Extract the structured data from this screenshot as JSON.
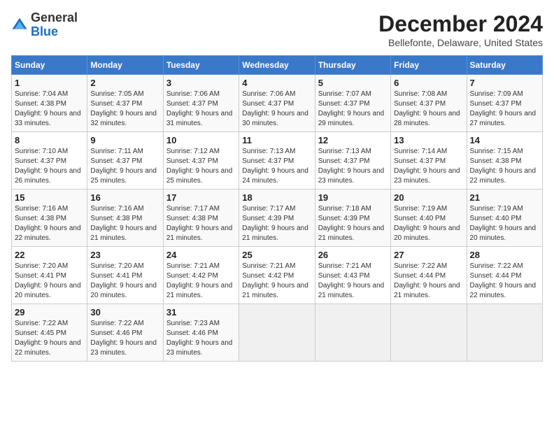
{
  "logo": {
    "general": "General",
    "blue": "Blue"
  },
  "title": "December 2024",
  "subtitle": "Bellefonte, Delaware, United States",
  "days_header": [
    "Sunday",
    "Monday",
    "Tuesday",
    "Wednesday",
    "Thursday",
    "Friday",
    "Saturday"
  ],
  "weeks": [
    [
      {
        "day": "1",
        "sunrise": "Sunrise: 7:04 AM",
        "sunset": "Sunset: 4:38 PM",
        "daylight": "Daylight: 9 hours and 33 minutes."
      },
      {
        "day": "2",
        "sunrise": "Sunrise: 7:05 AM",
        "sunset": "Sunset: 4:37 PM",
        "daylight": "Daylight: 9 hours and 32 minutes."
      },
      {
        "day": "3",
        "sunrise": "Sunrise: 7:06 AM",
        "sunset": "Sunset: 4:37 PM",
        "daylight": "Daylight: 9 hours and 31 minutes."
      },
      {
        "day": "4",
        "sunrise": "Sunrise: 7:06 AM",
        "sunset": "Sunset: 4:37 PM",
        "daylight": "Daylight: 9 hours and 30 minutes."
      },
      {
        "day": "5",
        "sunrise": "Sunrise: 7:07 AM",
        "sunset": "Sunset: 4:37 PM",
        "daylight": "Daylight: 9 hours and 29 minutes."
      },
      {
        "day": "6",
        "sunrise": "Sunrise: 7:08 AM",
        "sunset": "Sunset: 4:37 PM",
        "daylight": "Daylight: 9 hours and 28 minutes."
      },
      {
        "day": "7",
        "sunrise": "Sunrise: 7:09 AM",
        "sunset": "Sunset: 4:37 PM",
        "daylight": "Daylight: 9 hours and 27 minutes."
      }
    ],
    [
      {
        "day": "8",
        "sunrise": "Sunrise: 7:10 AM",
        "sunset": "Sunset: 4:37 PM",
        "daylight": "Daylight: 9 hours and 26 minutes."
      },
      {
        "day": "9",
        "sunrise": "Sunrise: 7:11 AM",
        "sunset": "Sunset: 4:37 PM",
        "daylight": "Daylight: 9 hours and 25 minutes."
      },
      {
        "day": "10",
        "sunrise": "Sunrise: 7:12 AM",
        "sunset": "Sunset: 4:37 PM",
        "daylight": "Daylight: 9 hours and 25 minutes."
      },
      {
        "day": "11",
        "sunrise": "Sunrise: 7:13 AM",
        "sunset": "Sunset: 4:37 PM",
        "daylight": "Daylight: 9 hours and 24 minutes."
      },
      {
        "day": "12",
        "sunrise": "Sunrise: 7:13 AM",
        "sunset": "Sunset: 4:37 PM",
        "daylight": "Daylight: 9 hours and 23 minutes."
      },
      {
        "day": "13",
        "sunrise": "Sunrise: 7:14 AM",
        "sunset": "Sunset: 4:37 PM",
        "daylight": "Daylight: 9 hours and 23 minutes."
      },
      {
        "day": "14",
        "sunrise": "Sunrise: 7:15 AM",
        "sunset": "Sunset: 4:38 PM",
        "daylight": "Daylight: 9 hours and 22 minutes."
      }
    ],
    [
      {
        "day": "15",
        "sunrise": "Sunrise: 7:16 AM",
        "sunset": "Sunset: 4:38 PM",
        "daylight": "Daylight: 9 hours and 22 minutes."
      },
      {
        "day": "16",
        "sunrise": "Sunrise: 7:16 AM",
        "sunset": "Sunset: 4:38 PM",
        "daylight": "Daylight: 9 hours and 21 minutes."
      },
      {
        "day": "17",
        "sunrise": "Sunrise: 7:17 AM",
        "sunset": "Sunset: 4:38 PM",
        "daylight": "Daylight: 9 hours and 21 minutes."
      },
      {
        "day": "18",
        "sunrise": "Sunrise: 7:17 AM",
        "sunset": "Sunset: 4:39 PM",
        "daylight": "Daylight: 9 hours and 21 minutes."
      },
      {
        "day": "19",
        "sunrise": "Sunrise: 7:18 AM",
        "sunset": "Sunset: 4:39 PM",
        "daylight": "Daylight: 9 hours and 21 minutes."
      },
      {
        "day": "20",
        "sunrise": "Sunrise: 7:19 AM",
        "sunset": "Sunset: 4:40 PM",
        "daylight": "Daylight: 9 hours and 20 minutes."
      },
      {
        "day": "21",
        "sunrise": "Sunrise: 7:19 AM",
        "sunset": "Sunset: 4:40 PM",
        "daylight": "Daylight: 9 hours and 20 minutes."
      }
    ],
    [
      {
        "day": "22",
        "sunrise": "Sunrise: 7:20 AM",
        "sunset": "Sunset: 4:41 PM",
        "daylight": "Daylight: 9 hours and 20 minutes."
      },
      {
        "day": "23",
        "sunrise": "Sunrise: 7:20 AM",
        "sunset": "Sunset: 4:41 PM",
        "daylight": "Daylight: 9 hours and 20 minutes."
      },
      {
        "day": "24",
        "sunrise": "Sunrise: 7:21 AM",
        "sunset": "Sunset: 4:42 PM",
        "daylight": "Daylight: 9 hours and 21 minutes."
      },
      {
        "day": "25",
        "sunrise": "Sunrise: 7:21 AM",
        "sunset": "Sunset: 4:42 PM",
        "daylight": "Daylight: 9 hours and 21 minutes."
      },
      {
        "day": "26",
        "sunrise": "Sunrise: 7:21 AM",
        "sunset": "Sunset: 4:43 PM",
        "daylight": "Daylight: 9 hours and 21 minutes."
      },
      {
        "day": "27",
        "sunrise": "Sunrise: 7:22 AM",
        "sunset": "Sunset: 4:44 PM",
        "daylight": "Daylight: 9 hours and 21 minutes."
      },
      {
        "day": "28",
        "sunrise": "Sunrise: 7:22 AM",
        "sunset": "Sunset: 4:44 PM",
        "daylight": "Daylight: 9 hours and 22 minutes."
      }
    ],
    [
      {
        "day": "29",
        "sunrise": "Sunrise: 7:22 AM",
        "sunset": "Sunset: 4:45 PM",
        "daylight": "Daylight: 9 hours and 22 minutes."
      },
      {
        "day": "30",
        "sunrise": "Sunrise: 7:22 AM",
        "sunset": "Sunset: 4:46 PM",
        "daylight": "Daylight: 9 hours and 23 minutes."
      },
      {
        "day": "31",
        "sunrise": "Sunrise: 7:23 AM",
        "sunset": "Sunset: 4:46 PM",
        "daylight": "Daylight: 9 hours and 23 minutes."
      },
      null,
      null,
      null,
      null
    ]
  ]
}
